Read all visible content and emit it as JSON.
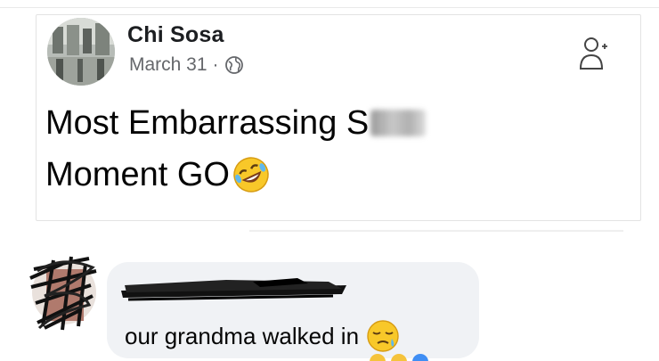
{
  "post": {
    "author": "Chi Sosa",
    "date": "March 31",
    "separator": "·",
    "privacy_icon": "globe-icon",
    "follow_icon": "person-add-icon",
    "text_line1": "Most Embarrassing S",
    "text_line2": "Moment GO",
    "censored": true,
    "emoji": "rolling-on-floor-laughing-emoji"
  },
  "comment": {
    "author_censored": true,
    "text": "our grandma walked in",
    "emoji": "sleepy-face-emoji"
  },
  "colors": {
    "card_border": "#e3e3e3",
    "bubble_bg": "#f0f2f5",
    "meta_text": "#65676b",
    "body_text": "#050505"
  }
}
